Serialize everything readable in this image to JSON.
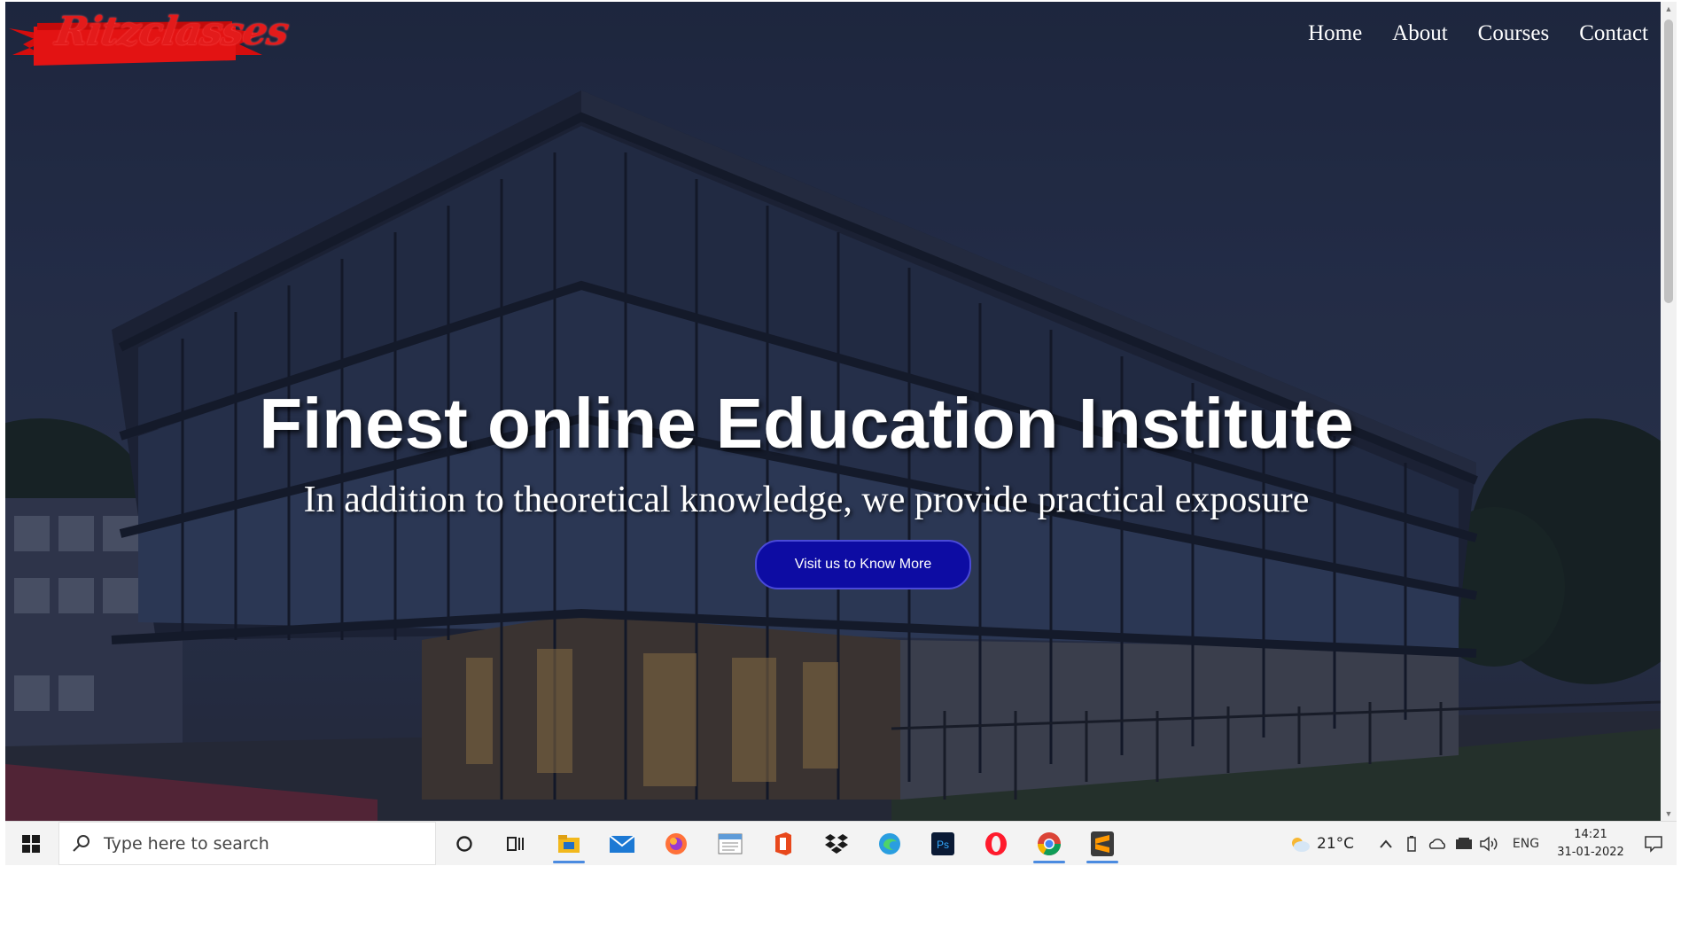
{
  "site": {
    "logo_text": "Ritzclasses",
    "nav": [
      "Home",
      "About",
      "Courses",
      "Contact"
    ],
    "hero": {
      "title": "Finest online Education Institute",
      "subtitle": "In addition to theoretical knowledge, we provide practical exposure",
      "cta_label": "Visit us to Know More"
    }
  },
  "taskbar": {
    "search_placeholder": "Type here to search",
    "apps": [
      "cortana-circle",
      "task-view",
      "file-explorer",
      "mail",
      "firefox",
      "notepad",
      "office",
      "dropbox",
      "edge",
      "photoshop",
      "opera",
      "chrome",
      "sublime-text"
    ],
    "photoshop_label": "Ps",
    "weather": "21°C",
    "language": "ENG",
    "time": "14:21",
    "date": "31-01-2022"
  },
  "colors": {
    "accent_button": "#0d0ca3",
    "logo_red": "#e31b1b",
    "hero_overlay": "#1a1f3a"
  }
}
